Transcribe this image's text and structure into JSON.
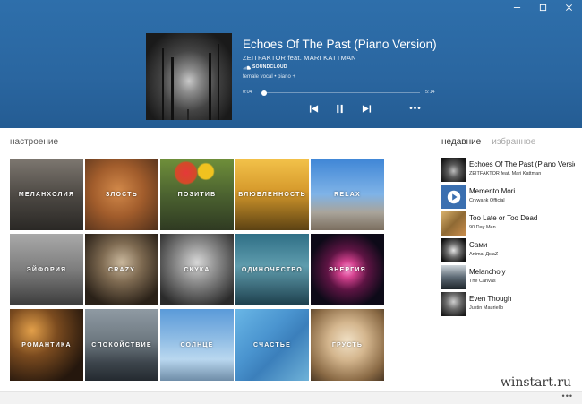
{
  "window": {
    "minimize_icon": "minimize-icon",
    "maximize_icon": "maximize-icon",
    "close_icon": "close-icon"
  },
  "player": {
    "title": "Echoes Of The Past (Piano Version)",
    "artist": "ZEITFAKTOR feat. MARI KATTMAN",
    "source": "SOUNDCLOUD",
    "tags": "female vocal  •  piano  +",
    "time_current": "0:04",
    "time_total": "5:14",
    "progress": 0.013,
    "more": "•••"
  },
  "mood": {
    "label": "настроение",
    "tiles": [
      {
        "label": "меланхолия"
      },
      {
        "label": "злость"
      },
      {
        "label": "позитив"
      },
      {
        "label": "влюбленность"
      },
      {
        "label": "relax"
      },
      {
        "label": "эйфория"
      },
      {
        "label": "crazy"
      },
      {
        "label": "скука"
      },
      {
        "label": "одиночество"
      },
      {
        "label": "энергия"
      },
      {
        "label": "романтика"
      },
      {
        "label": "спокойствие"
      },
      {
        "label": "солнце"
      },
      {
        "label": "счастье"
      },
      {
        "label": "грусть"
      }
    ]
  },
  "sidebar": {
    "tab_recent": "недавние",
    "tab_favorites": "избранное",
    "items": [
      {
        "title": "Echoes Of The Past (Piano Version)",
        "artist": "ZEITFAKTOR feat. Mari Kattman"
      },
      {
        "title": "Memento Mori",
        "artist": "Crywank Official"
      },
      {
        "title": "Too Late or Too Dead",
        "artist": "90 Day Men"
      },
      {
        "title": "Сами",
        "artist": "Animal ДжаZ"
      },
      {
        "title": "Melancholy",
        "artist": "The Canvas"
      },
      {
        "title": "Even Though",
        "artist": "Justin Mauriello"
      }
    ]
  },
  "footer": {
    "more": "•••",
    "watermark": "winstart.ru"
  }
}
